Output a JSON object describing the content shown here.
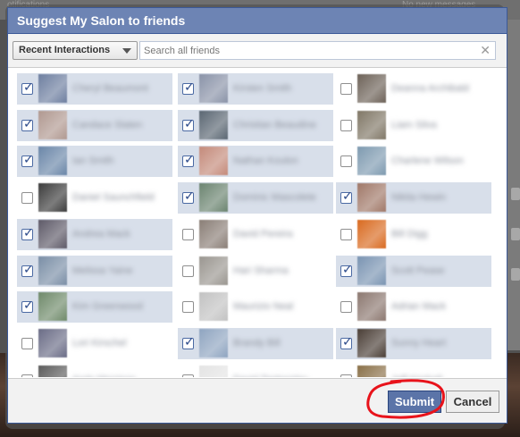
{
  "colors": {
    "header_bg": "#6d84b4",
    "header_border": "#3b5998",
    "selected_row_bg": "#d8dfea",
    "submit_bg": "#5b74a8",
    "annotation_red": "#e8131b"
  },
  "background_page": {
    "top_left_text": "otifications",
    "top_right_text": "No new messages"
  },
  "dialog": {
    "title": "Suggest My Salon to friends"
  },
  "toolbar": {
    "filter_selected": "Recent Interactions",
    "search_placeholder": "Search all friends",
    "clear_icon": "close-icon"
  },
  "friends": [
    {
      "name": "Cheryl Beaumont",
      "checked": true,
      "color": "#6e7fa0"
    },
    {
      "name": "Kirsten Smith",
      "checked": true,
      "color": "#8a93a8"
    },
    {
      "name": "Deanna Archibald",
      "checked": false,
      "color": "#6d6258"
    },
    {
      "name": "Candace Slaten",
      "checked": true,
      "color": "#b09890"
    },
    {
      "name": "Christian Beaudine",
      "checked": true,
      "color": "#5a6672"
    },
    {
      "name": "Liam Silva",
      "checked": false,
      "color": "#807766"
    },
    {
      "name": "Ian Smith",
      "checked": true,
      "color": "#6a86a8"
    },
    {
      "name": "Nathan Koulon",
      "checked": true,
      "color": "#c48a7a"
    },
    {
      "name": "Charlene Wilson",
      "checked": false,
      "color": "#7e9ab0"
    },
    {
      "name": "Daniel Saunchfield",
      "checked": false,
      "color": "#3c3c3c"
    },
    {
      "name": "Dominic Mascolete",
      "checked": true,
      "color": "#6b8470"
    },
    {
      "name": "Nikita Hewin",
      "checked": true,
      "color": "#a07868"
    },
    {
      "name": "Andrea Mack",
      "checked": true,
      "color": "#5e5a68"
    },
    {
      "name": "David Pereira",
      "checked": false,
      "color": "#8a7e76"
    },
    {
      "name": "Bill Digg",
      "checked": false,
      "color": "#d96a20"
    },
    {
      "name": "Melissa Yaine",
      "checked": true,
      "color": "#7a8ea6"
    },
    {
      "name": "Hari Sharma",
      "checked": false,
      "color": "#9a9690"
    },
    {
      "name": "Scott Pease",
      "checked": true,
      "color": "#7a94b2"
    },
    {
      "name": "Kim Greenwood",
      "checked": true,
      "color": "#6f8a6a"
    },
    {
      "name": "Maurizio Neal",
      "checked": false,
      "color": "#c2c2c2"
    },
    {
      "name": "Adrian Mack",
      "checked": false,
      "color": "#8c7870"
    },
    {
      "name": "Lori Kirschel",
      "checked": false,
      "color": "#6a6c86"
    },
    {
      "name": "Brandy Bill",
      "checked": true,
      "color": "#8ea4c0"
    },
    {
      "name": "Sunny Heart",
      "checked": true,
      "color": "#4a3e36"
    },
    {
      "name": "Andy Morrison",
      "checked": false,
      "color": "#5c5c5c"
    },
    {
      "name": "David Tankersley",
      "checked": false,
      "color": "#e4e4e4"
    },
    {
      "name": "Jeff Kimball",
      "checked": false,
      "color": "#8a7048"
    }
  ],
  "footer": {
    "submit_label": "Submit",
    "cancel_label": "Cancel"
  }
}
